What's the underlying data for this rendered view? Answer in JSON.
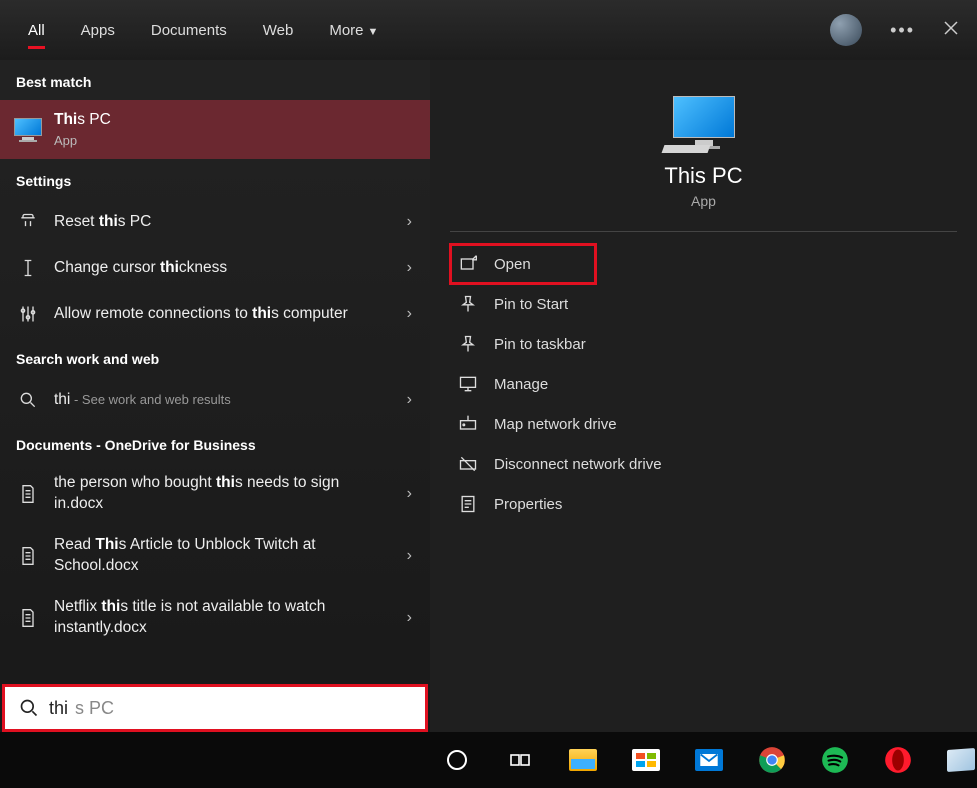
{
  "tabs": {
    "all": "All",
    "apps": "Apps",
    "documents": "Documents",
    "web": "Web",
    "more": "More"
  },
  "sections": {
    "best_match": "Best match",
    "settings": "Settings",
    "search_work_web": "Search work and web",
    "docs_onedrive": "Documents - OneDrive for Business"
  },
  "best": {
    "title_prefix": "Thi",
    "title_rest": "s PC",
    "subtitle": "App"
  },
  "settings_items": {
    "reset_pre": "Reset ",
    "reset_b": "thi",
    "reset_post": "s PC",
    "cursor_pre": "Change cursor ",
    "cursor_b": "thi",
    "cursor_post": "ckness",
    "remote_pre": "Allow remote connections to ",
    "remote_b": "thi",
    "remote_post": "s computer"
  },
  "web_item": {
    "term": "thi",
    "hint": " - See work and web results"
  },
  "docs": {
    "d1_pre": "the person who bought ",
    "d1_b": "thi",
    "d1_post": "s needs to sign in.docx",
    "d2_pre": "Read ",
    "d2_b": "Thi",
    "d2_post": "s Article to Unblock Twitch at School.docx",
    "d3_pre": "Netflix ",
    "d3_b": "thi",
    "d3_post": "s title is not available to watch instantly.docx"
  },
  "preview": {
    "title": "This PC",
    "subtitle": "App"
  },
  "actions": {
    "open": "Open",
    "pin_start": "Pin to Start",
    "pin_taskbar": "Pin to taskbar",
    "manage": "Manage",
    "map_drive": "Map network drive",
    "disconnect_drive": "Disconnect network drive",
    "properties": "Properties"
  },
  "search": {
    "value": "thi",
    "placeholder": "s PC"
  }
}
